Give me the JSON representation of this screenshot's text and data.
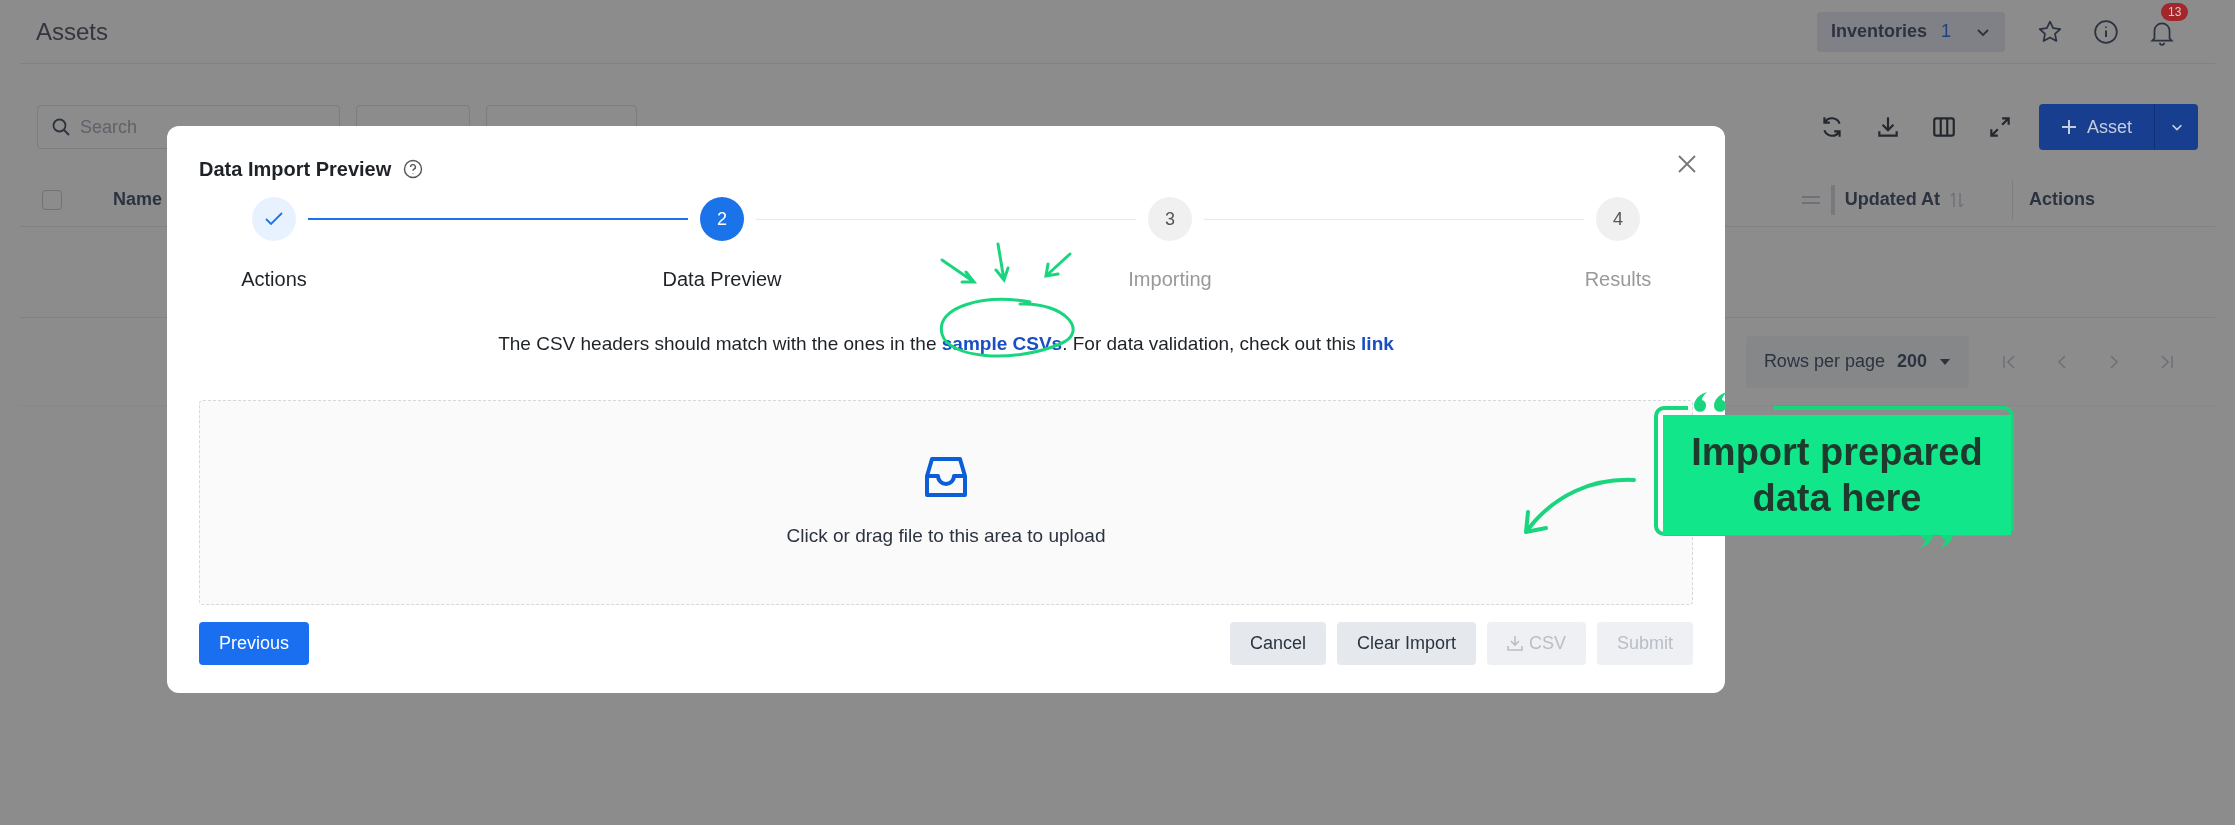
{
  "header": {
    "title": "Assets",
    "inventories": {
      "label": "Inventories",
      "count": "1"
    },
    "notification_badge": "13"
  },
  "toolbar": {
    "search": {
      "placeholder": "Search"
    },
    "add_button": "Asset"
  },
  "table": {
    "select_all_checked": false,
    "columns": [
      "Name",
      "Updated At",
      "Actions"
    ]
  },
  "pagination": {
    "rows_per_page_label": "Rows per page",
    "rows_per_page": "200"
  },
  "dialog": {
    "title": "Data Import Preview",
    "steps": [
      {
        "label": "Actions",
        "done": true,
        "selected": false
      },
      {
        "number": "2",
        "label": "Data Preview",
        "done": false,
        "selected": true
      },
      {
        "number": "3",
        "label": "Importing",
        "done": false,
        "selected": false
      },
      {
        "number": "4",
        "label": "Results",
        "done": false,
        "selected": false
      }
    ],
    "instructions": [
      {
        "kind": "text",
        "text": "The CSV headers should match with the ones in the "
      },
      {
        "kind": "link",
        "text": "sample CSVs"
      },
      {
        "kind": "text",
        "text": ". For data validation, check out this "
      },
      {
        "kind": "link",
        "text": "link"
      }
    ],
    "upload": {
      "text": "Click or drag file to this area to upload"
    },
    "buttons": [
      {
        "label": "Previous",
        "kind": "primary",
        "disabled": false
      },
      {
        "label": "Cancel",
        "kind": "default",
        "disabled": false
      },
      {
        "label": "Clear Import",
        "kind": "default",
        "disabled": false
      },
      {
        "label": "CSV",
        "kind": "download",
        "disabled": true
      },
      {
        "label": "Submit",
        "kind": "default",
        "disabled": true
      }
    ]
  },
  "annotation": {
    "text": "Import prepared data here"
  }
}
